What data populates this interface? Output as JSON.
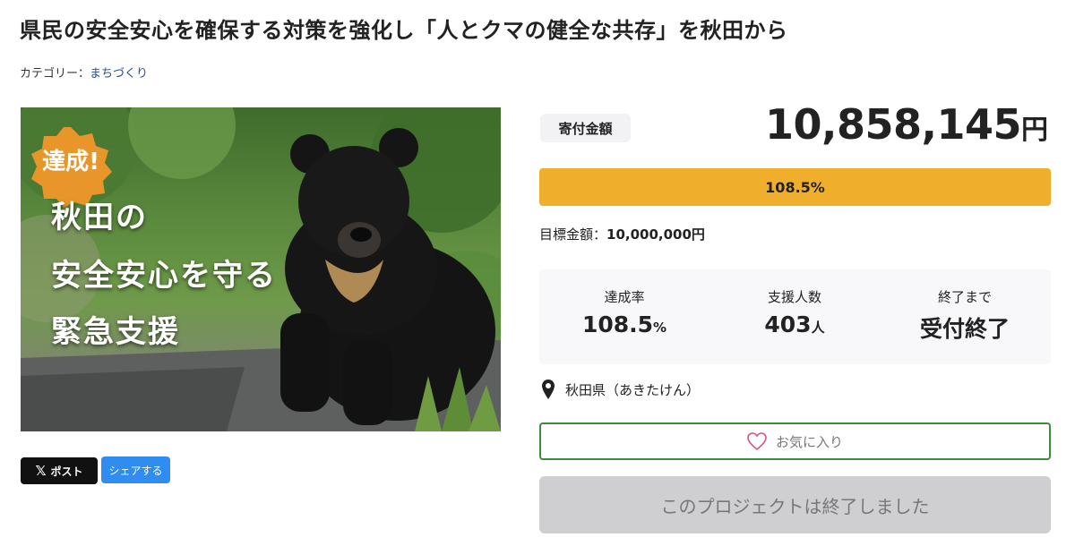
{
  "page": {
    "title": "県民の安全安心を確保する対策を強化し「人とクマの健全な共存」を秋田から",
    "category_label": "カテゴリー：",
    "category_value": "まちづくり"
  },
  "hero": {
    "badge": "達成!",
    "lines": [
      "秋田の",
      "安全安心を守る",
      "緊急支援"
    ]
  },
  "share": {
    "x_label": "ポスト",
    "x_icon": "x-logo-icon",
    "share_label": "シェアする"
  },
  "donation": {
    "label": "寄付金額",
    "amount": "10,858,145",
    "unit": "円",
    "progress_text": "108.5%",
    "progress_fraction": 1.0,
    "goal_label": "目標金額：",
    "goal_value": "10,000,000円"
  },
  "stats": [
    {
      "label": "達成率",
      "value": "108.5",
      "unit": "%"
    },
    {
      "label": "支援人数",
      "value": "403",
      "unit": "人"
    },
    {
      "label": "終了まで",
      "value": "受付終了",
      "unit": ""
    }
  ],
  "location": {
    "icon": "map-pin-icon",
    "text": "秋田県（あきたけん）"
  },
  "favorite": {
    "icon": "heart-icon",
    "label": "お気に入り"
  },
  "status_button": "このプロジェクトは終了しました",
  "colors": {
    "progress": "#f0ae2d",
    "favorite_border": "#3c8c3a",
    "share_button": "#2f8cf0",
    "badge": "#e8962a"
  }
}
